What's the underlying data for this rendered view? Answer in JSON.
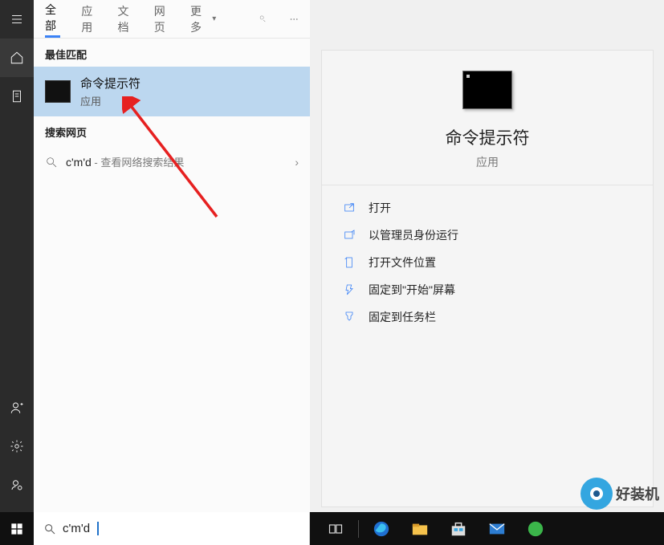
{
  "tabs": {
    "all": "全部",
    "apps": "应用",
    "docs": "文档",
    "web": "网页",
    "more": "更多"
  },
  "sections": {
    "best_match": "最佳匹配",
    "search_web": "搜索网页"
  },
  "best_match": {
    "title": "命令提示符",
    "subtitle": "应用"
  },
  "web_search": {
    "query": "c'm'd",
    "hint": " - 查看网络搜索结果"
  },
  "detail": {
    "title": "命令提示符",
    "type": "应用",
    "actions": {
      "open": "打开",
      "run_admin": "以管理员身份运行",
      "open_location": "打开文件位置",
      "pin_start": "固定到\"开始\"屏幕",
      "pin_taskbar": "固定到任务栏"
    }
  },
  "taskbar": {
    "search_value": "c'm'd"
  },
  "watermark": "好装机",
  "colors": {
    "accent": "#3b82f6",
    "selected_bg": "#bcd7ef",
    "arrow": "#e62020"
  }
}
